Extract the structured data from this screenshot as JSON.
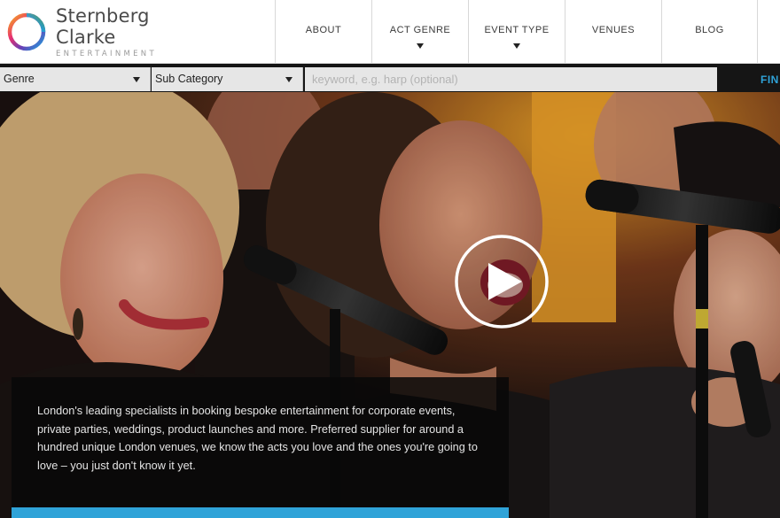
{
  "brand": {
    "name": "Sternberg Clarke",
    "tagline": "ENTERTAINMENT",
    "colors": {
      "accent": "#2fa3d8",
      "nav_text": "#3a3a3a"
    }
  },
  "nav": {
    "items": [
      {
        "label": "ABOUT",
        "dropdown": false
      },
      {
        "label": "ACT GENRE",
        "dropdown": true
      },
      {
        "label": "EVENT TYPE",
        "dropdown": true
      },
      {
        "label": "VENUES",
        "dropdown": false
      },
      {
        "label": "BLOG",
        "dropdown": false
      }
    ]
  },
  "search": {
    "genre": {
      "selected": "Genre"
    },
    "subcategory": {
      "selected": "Sub Category"
    },
    "keyword": {
      "value": "",
      "placeholder": "keyword, e.g. harp (optional)"
    },
    "find_label": "FIN"
  },
  "hero": {
    "play_icon": "play-icon",
    "intro": "London's leading specialists in booking bespoke entertainment for corporate events, private parties, weddings, product launches and more. Preferred supplier for around a hundred unique London venues, we know the acts you love and the ones you're going to love – you just don't know it yet."
  }
}
